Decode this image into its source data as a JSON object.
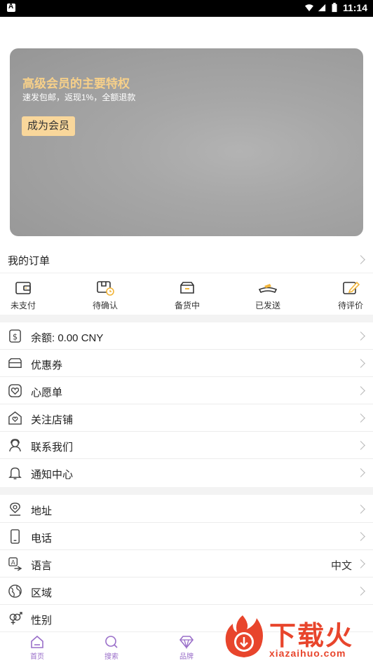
{
  "status_bar": {
    "time": "11:14"
  },
  "banner": {
    "title": "高级会员的主要特权",
    "subtitle": "速发包邮，返现1%，全额退款",
    "button": "成为会员"
  },
  "orders": {
    "title": "我的订单",
    "items": [
      {
        "label": "未支付",
        "icon": "wallet-icon"
      },
      {
        "label": "待确认",
        "icon": "package-clock-icon"
      },
      {
        "label": "备货中",
        "icon": "box-icon"
      },
      {
        "label": "已发送",
        "icon": "delivery-icon"
      },
      {
        "label": "待评价",
        "icon": "review-pen-icon"
      }
    ]
  },
  "menu1": [
    {
      "label": "余额: 0.00 CNY",
      "icon": "balance-icon"
    },
    {
      "label": "优惠券",
      "icon": "coupon-icon"
    },
    {
      "label": "心愿单",
      "icon": "heart-icon"
    },
    {
      "label": "关注店铺",
      "icon": "store-heart-icon"
    },
    {
      "label": "联系我们",
      "icon": "support-icon"
    },
    {
      "label": "通知中心",
      "icon": "bell-icon"
    }
  ],
  "menu2": [
    {
      "label": "地址",
      "icon": "location-icon"
    },
    {
      "label": "电话",
      "icon": "phone-icon"
    },
    {
      "label": "语言",
      "icon": "language-icon",
      "value": "中文"
    },
    {
      "label": "区域",
      "icon": "globe-icon"
    },
    {
      "label": "性别",
      "icon": "gender-icon"
    }
  ],
  "bottom_nav": [
    {
      "label": "首页",
      "icon": "home-icon"
    },
    {
      "label": "搜索",
      "icon": "search-icon"
    },
    {
      "label": "品牌",
      "icon": "diamond-icon"
    }
  ],
  "watermark": {
    "text": "下载火",
    "sub": "xiazaihuo.com"
  },
  "colors": {
    "accent": "#9a6fc9",
    "banner_title": "#f7d089",
    "member_button": "#f9d79b",
    "watermark": "#e8452c"
  }
}
